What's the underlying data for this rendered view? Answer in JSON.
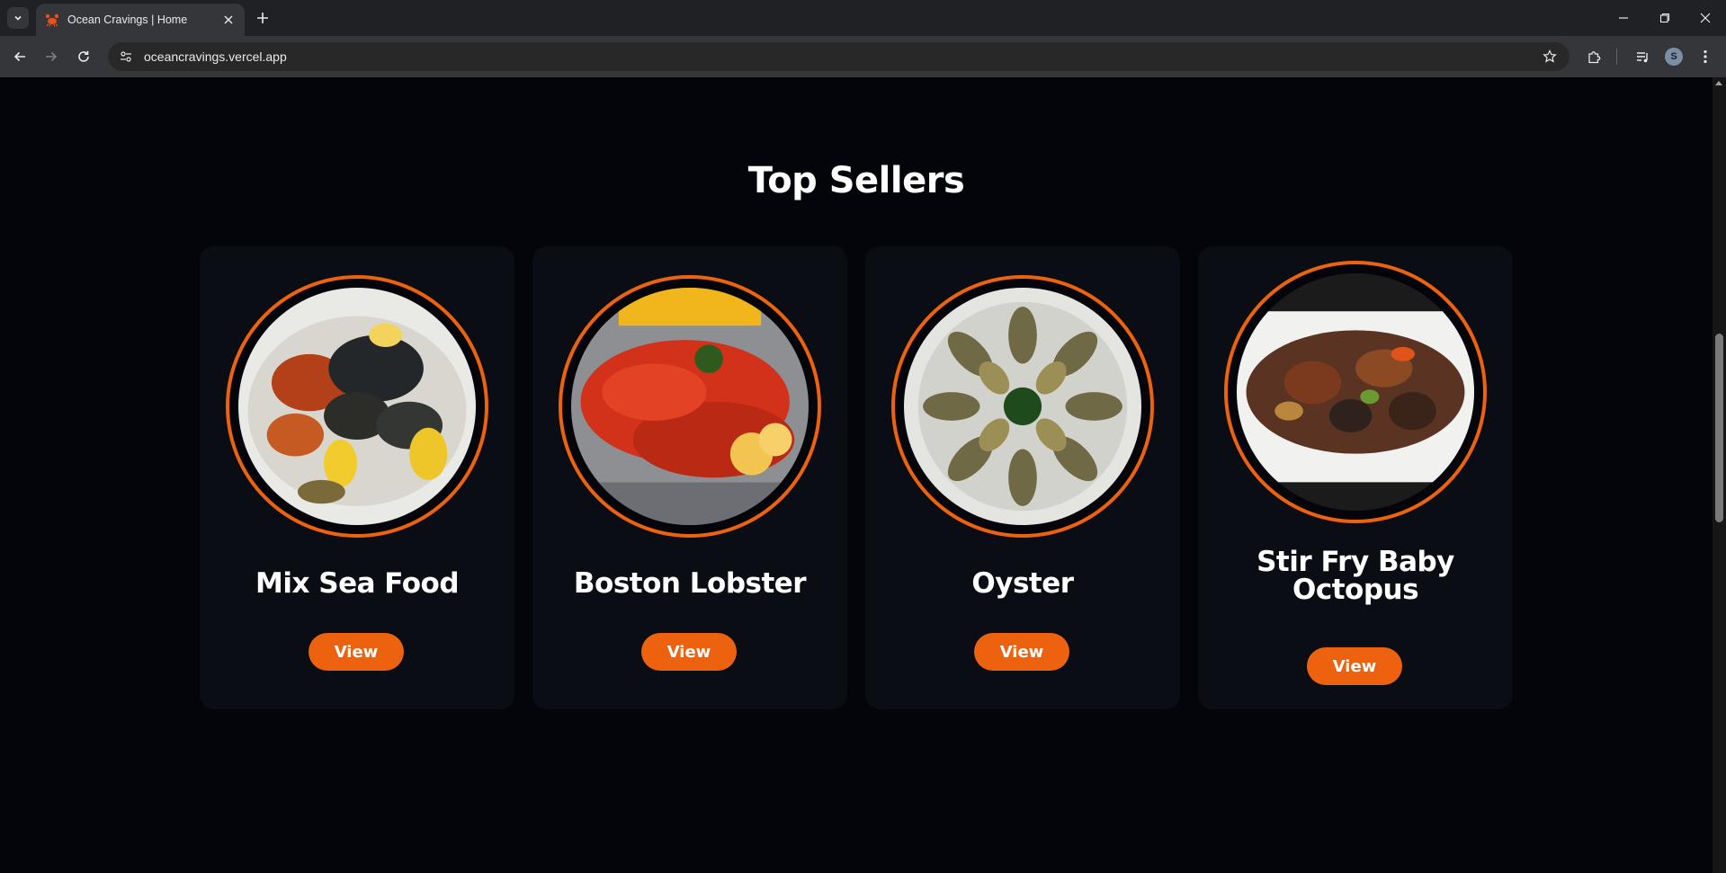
{
  "browser": {
    "tab_title": "Ocean Cravings | Home",
    "url": "oceancravings.vercel.app",
    "avatar_letter": "S"
  },
  "page": {
    "section_title": "Top Sellers",
    "cards": [
      {
        "name": "Mix Sea Food",
        "button": "View",
        "image": "mixed-seafood-plate"
      },
      {
        "name": "Boston Lobster",
        "button": "View",
        "image": "lobster-plate"
      },
      {
        "name": "Oyster",
        "button": "View",
        "image": "oyster-platter"
      },
      {
        "name": "Stir Fry Baby Octopus",
        "button": "View",
        "image": "octopus-stirfry-plate"
      }
    ]
  },
  "colors": {
    "accent": "#ec620f",
    "page_bg": "#03050b",
    "card_bg": "#0b0d14",
    "text": "#ffffff"
  }
}
